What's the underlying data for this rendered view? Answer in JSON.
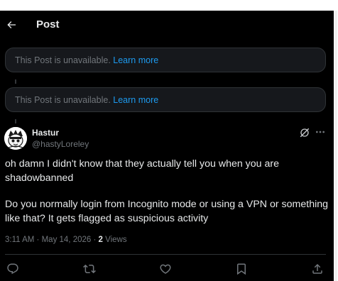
{
  "header": {
    "title": "Post"
  },
  "unavailable_posts": [
    {
      "text": "This Post is unavailable.",
      "link": "Learn more"
    },
    {
      "text": "This Post is unavailable.",
      "link": "Learn more"
    }
  ],
  "post": {
    "display_name": "Hastur",
    "handle": "@hastyLoreley",
    "paragraphs": [
      "oh damn I didn't know that they actually tell you when you are shadowbanned",
      "Do you normally login from Incognito mode or using a VPN or something like that? It gets flagged as suspicious activity"
    ],
    "time": "3:11 AM",
    "separator": "·",
    "date": "May 14, 2026",
    "views_separator": "·",
    "view_count": "2",
    "views_label": "Views"
  },
  "icons": {
    "back": "arrow-left-icon",
    "grok": "grok-icon",
    "more": "more-icon",
    "reply": "reply-icon",
    "repost": "repost-icon",
    "like": "like-icon",
    "bookmark": "bookmark-icon",
    "share": "share-icon"
  },
  "colors": {
    "background": "#000000",
    "text": "#e7e9ea",
    "secondary": "#71767b",
    "link": "#1d9bf0",
    "border": "#2f3336"
  }
}
